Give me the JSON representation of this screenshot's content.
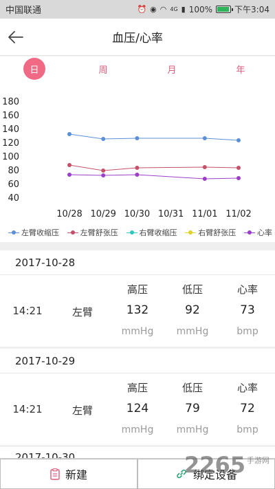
{
  "status_bar": {
    "carrier": "中国联通",
    "battery_pct_label": "100%",
    "battery_level": 1.0,
    "time": "下午3:04",
    "signal_label": "4G"
  },
  "header": {
    "title": "血压/心率",
    "back_icon": "arrow-left-icon"
  },
  "tabs": [
    {
      "label": "日",
      "active": true
    },
    {
      "label": "周",
      "active": false
    },
    {
      "label": "月",
      "active": false
    },
    {
      "label": "年",
      "active": false
    }
  ],
  "chart_data": {
    "type": "line",
    "x": [
      "10/28",
      "10/29",
      "10/30",
      "10/31",
      "11/01",
      "11/02"
    ],
    "ylim": [
      40,
      180
    ],
    "yticks": [
      40,
      60,
      80,
      100,
      120,
      140,
      160,
      180
    ],
    "grid": false,
    "legend_position": "bottom",
    "series": [
      {
        "name": "左臂收缩压",
        "color": "#5b8fd6",
        "x_index": [
          0,
          1,
          2,
          4,
          5
        ],
        "values": [
          132,
          125,
          126,
          126,
          123
        ]
      },
      {
        "name": "左臂舒张压",
        "color": "#c6506a",
        "x_index": [
          0,
          1,
          2,
          4,
          5
        ],
        "values": [
          87,
          79,
          83,
          84,
          83
        ]
      },
      {
        "name": "右臂收缩压",
        "color": "#2fc8c0",
        "x_index": [],
        "values": []
      },
      {
        "name": "右臂舒张压",
        "color": "#e3d02a",
        "x_index": [],
        "values": []
      },
      {
        "name": "心率",
        "color": "#9b3fc9",
        "x_index": [
          0,
          1,
          2,
          4,
          5
        ],
        "values": [
          73,
          72,
          73,
          67,
          68
        ]
      }
    ]
  },
  "records": [
    {
      "date": "2017-10-28",
      "time": "14:21",
      "arm": "左臂",
      "headers": [
        "高压",
        "低压",
        "心率"
      ],
      "values": [
        "132",
        "92",
        "73"
      ],
      "units": [
        "mmHg",
        "mmHg",
        "bmp"
      ]
    },
    {
      "date": "2017-10-29",
      "time": "14:21",
      "arm": "左臂",
      "headers": [
        "高压",
        "低压",
        "心率"
      ],
      "values": [
        "124",
        "79",
        "72"
      ],
      "units": [
        "mmHg",
        "mmHg",
        "bmp"
      ]
    }
  ],
  "next_record_date": "2017-10-30",
  "bottom_bar": {
    "new_label": "新建",
    "bind_label": "绑定设备"
  },
  "watermark": {
    "text": "2265",
    "subtext": "手游网"
  }
}
